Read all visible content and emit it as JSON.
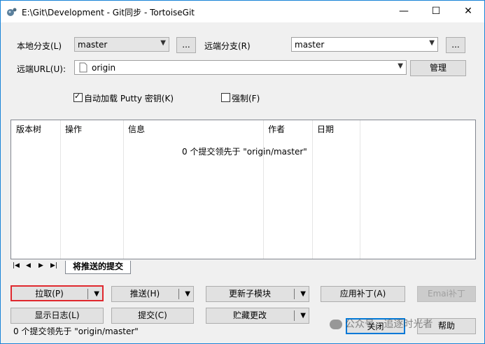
{
  "window": {
    "title": "E:\\Git\\Development - Git同步 - TortoiseGit",
    "minimize": "—",
    "maximize": "☐",
    "close": "✕"
  },
  "form": {
    "local_branch_label": "本地分支(L)",
    "local_branch_value": "master",
    "ellipsis": "...",
    "remote_branch_label": "远端分支(R)",
    "remote_branch_value": "master",
    "remote_url_label": "远端URL(U):",
    "remote_url_value": "origin",
    "manage_button": "管理",
    "autoload_putty_label": "自动加载 Putty 密钥(K)",
    "autoload_putty_checked": true,
    "force_label": "强制(F)",
    "force_checked": false
  },
  "list": {
    "columns": [
      "版本树",
      "操作",
      "信息",
      "作者",
      "日期"
    ],
    "empty_message": "0 个提交领先于 \"origin/master\""
  },
  "tabs": {
    "active": "将推送的提交",
    "nav": [
      "|◀",
      "◀",
      "▶",
      "▶|"
    ]
  },
  "buttons": {
    "pull": "拉取(P)",
    "push": "推送(H)",
    "update_submodules": "更新子模块",
    "apply_patch": "应用补丁(A)",
    "email_patch": "Emai补丁",
    "show_log": "显示日志(L)",
    "commit": "提交(C)",
    "stash": "贮藏更改",
    "close": "关闭",
    "help": "帮助"
  },
  "status": "0 个提交领先于 \"origin/master\"",
  "watermark": "公众号 · 追逐时光者",
  "colors": {
    "accent": "#1883d7",
    "highlight_border": "#e0282e"
  }
}
